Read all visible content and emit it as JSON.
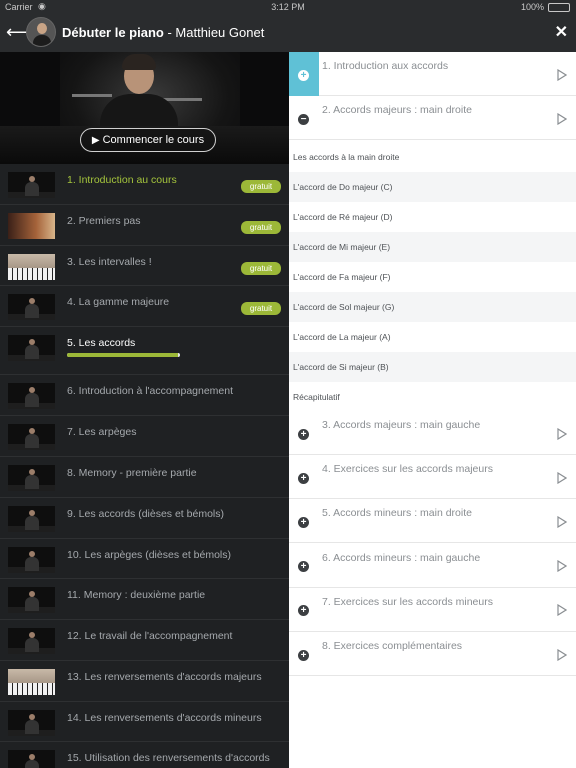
{
  "status_bar": {
    "carrier": "Carrier",
    "time": "3:12 PM",
    "battery": "100%"
  },
  "header": {
    "course_title": "Débuter le piano",
    "separator": " - ",
    "instructor": "Matthieu Gonet"
  },
  "hero": {
    "start_label": "Commencer le cours"
  },
  "lessons": [
    {
      "label": "1. Introduction au cours",
      "badge": "gratuit",
      "state": "active"
    },
    {
      "label": "2. Premiers pas",
      "badge": "gratuit"
    },
    {
      "label": "3. Les intervalles !",
      "badge": "gratuit"
    },
    {
      "label": "4. La gamme majeure",
      "badge": "gratuit"
    },
    {
      "label": "5. Les accords",
      "state": "current",
      "progress": 0.98
    },
    {
      "label": "6. Introduction à l'accompagnement"
    },
    {
      "label": "7. Les arpèges"
    },
    {
      "label": "8. Memory - première partie"
    },
    {
      "label": "9. Les accords (dièses et bémols)"
    },
    {
      "label": "10. Les arpèges (dièses et bémols)"
    },
    {
      "label": "11. Memory : deuxième partie"
    },
    {
      "label": "12. Le travail de l'accompagnement"
    },
    {
      "label": "13. Les renversements d'accords majeurs"
    },
    {
      "label": "14. Les renversements d'accords mineurs"
    },
    {
      "label": "15. Utilisation des renversements d'accords"
    }
  ],
  "chapters_top": [
    {
      "label": "1. Introduction aux accords",
      "icon": "plus",
      "highlight": true
    },
    {
      "label": "2. Accords majeurs : main droite",
      "icon": "minus"
    }
  ],
  "subitems": [
    "Les accords à la main droite",
    "L'accord de Do majeur (C)",
    "L'accord de Ré majeur (D)",
    "L'accord de Mi majeur (E)",
    "L'accord de Fa majeur (F)",
    "L'accord de Sol majeur (G)",
    "L'accord de La majeur (A)",
    "L'accord de Si majeur (B)",
    "Récapitulatif"
  ],
  "chapters_bottom": [
    {
      "label": "3. Accords majeurs : main gauche",
      "icon": "plus"
    },
    {
      "label": "4. Exercices sur les accords majeurs",
      "icon": "plus"
    },
    {
      "label": "5. Accords mineurs : main droite",
      "icon": "plus"
    },
    {
      "label": "6. Accords mineurs : main gauche",
      "icon": "plus"
    },
    {
      "label": "7. Exercices sur les accords mineurs",
      "icon": "plus"
    },
    {
      "label": "8. Exercices complémentaires",
      "icon": "plus"
    }
  ],
  "colors": {
    "accent_green": "#9cb838",
    "accent_blue": "#5fc1d6",
    "dark_bg": "#1f2123"
  }
}
